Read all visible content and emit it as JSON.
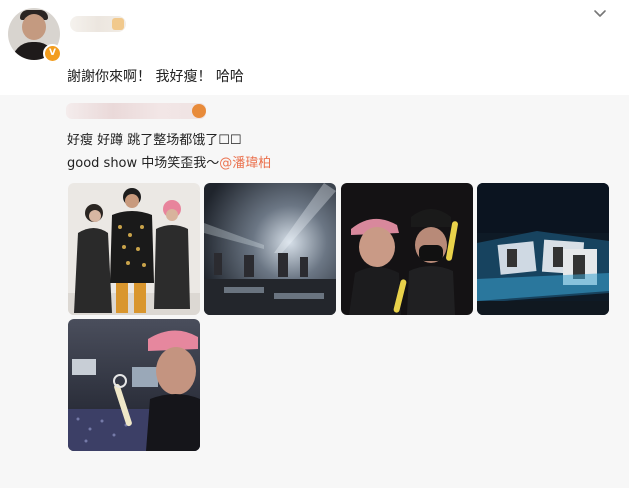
{
  "post": {
    "author_badge": "V",
    "text": "謝謝你來啊！ 我好瘦！ 哈哈"
  },
  "repost": {
    "line1": "好瘦 好蹲 跳了整场都饿了☐☐",
    "line2_prefix": "good show 中场笑歪我～",
    "mention": "@潘瑋柏"
  },
  "icons": {
    "menu": "chevron-down-icon",
    "verified": "verified-badge-icon"
  },
  "colors": {
    "accent": "#eb7350",
    "repost_bg": "#f7f7f7",
    "badge": "#f29d1f"
  },
  "photos": [
    {
      "name": "photo-group-portrait"
    },
    {
      "name": "photo-concert-stage"
    },
    {
      "name": "photo-selfie-lightsticks"
    },
    {
      "name": "photo-stage-screens"
    },
    {
      "name": "photo-selfie-arena"
    }
  ]
}
